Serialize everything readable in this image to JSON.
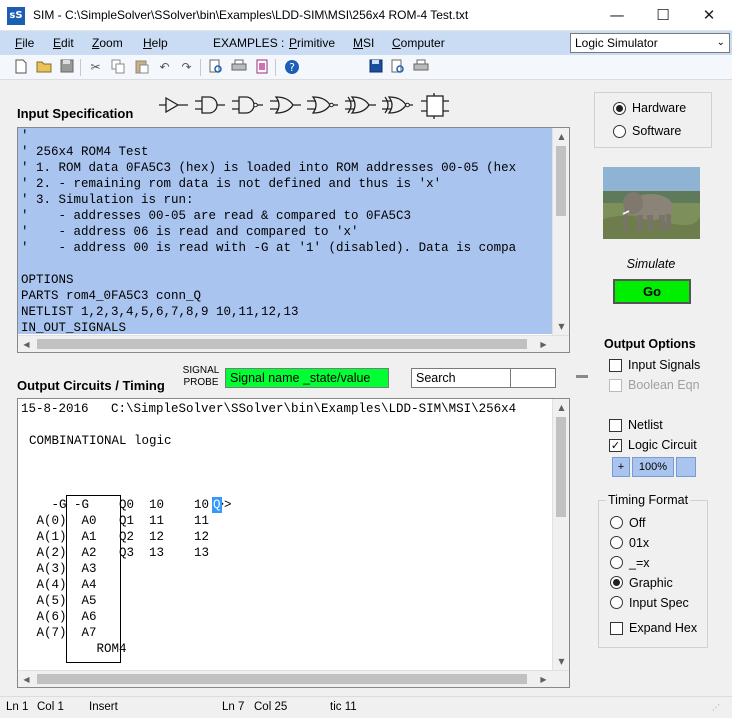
{
  "window": {
    "app_icon": "sS",
    "title": "SIM - C:\\SimpleSolver\\SSolver\\bin\\Examples\\LDD-SIM\\MSI\\256x4 ROM-4 Test.txt",
    "minimize": "—",
    "maximize": "☐",
    "close": "✕"
  },
  "menu": {
    "file": "File",
    "edit": "Edit",
    "zoom": "Zoom",
    "help": "Help",
    "examples_label": "EXAMPLES :",
    "primitive": "Primitive",
    "msi": "MSI",
    "computer": "Computer"
  },
  "mode_select": {
    "value": "Logic Simulator"
  },
  "toolbar_icons": [
    "new-file-icon",
    "open-folder-icon",
    "save-icon",
    "cut-icon",
    "copy-icon",
    "paste-icon",
    "undo-icon",
    "redo-icon",
    "print-preview-icon",
    "print-icon",
    "page-setup-icon",
    "help-icon",
    "save-output-icon",
    "print-preview-output-icon",
    "print-output-icon"
  ],
  "input_spec": {
    "title": "Input Specification",
    "gate_icons": [
      "buffer-gate-icon",
      "and-gate-icon",
      "nand-gate-icon",
      "or-gate-icon",
      "nor-gate-icon",
      "xor-gate-icon",
      "xnor-gate-icon",
      "flipflop-icon"
    ],
    "text": "'\n' 256x4 ROM4 Test\n' 1. ROM data 0FA5C3 (hex) is loaded into ROM addresses 00-05 (hex\n' 2. - remaining rom data is not defined and thus is 'x'\n' 3. Simulation is run:\n'    - addresses 00-05 are read & compared to 0FA5C3\n'    - address 06 is read and compared to 'x'\n'    - address 00 is read with -G at '1' (disabled). Data is compa\n\nOPTIONS\nPARTS rom4_0FA5C3 conn_Q\nNETLIST 1,2,3,4,5,6,7,8,9 10,11,12,13\nIN_OUT_SIGNALS"
  },
  "output_circuits": {
    "title": "Output Circuits / Timing",
    "probe_label": "SIGNAL\nPROBE",
    "probe_value": "Signal name _state/value",
    "search_value": "Search",
    "header_line": "15-8-2016   C:\\SimpleSolver\\SSolver\\bin\\Examples\\LDD-SIM\\MSI\\256x4",
    "logic_title": "COMBINATIONAL logic",
    "circuit_lines": [
      "   -G -G    Q0  10    10 >> ",
      " A(0)  A0   Q1  11    11",
      " A(1)  A1   Q2  12    12",
      " A(2)  A2   Q3  13    13",
      " A(3)  A3",
      " A(4)  A4",
      " A(5)  A5",
      " A(6)  A6",
      " A(7)  A7",
      "         ROM4"
    ],
    "cursor_char": "Q"
  },
  "side_panel": {
    "hardware": "Hardware",
    "software": "Software",
    "engine_selected": "Hardware",
    "simulate_label": "Simulate",
    "go_label": "Go",
    "output_options_title": "Output Options",
    "input_signals": "Input Signals",
    "boolean_eqn": "Boolean Eqn",
    "netlist": "Netlist",
    "logic_circuit": "Logic Circuit",
    "zoom_in": "+",
    "zoom_level": "100%",
    "timing_format_title": "Timing Format",
    "timing_off": "Off",
    "timing_01x": "01x",
    "timing_eqx": "_=x",
    "timing_graphic": "Graphic",
    "timing_input_spec": "Input Spec",
    "expand_hex": "Expand Hex"
  },
  "status": {
    "ln1": "Ln 1",
    "col1": "Col 1",
    "mode": "Insert",
    "ln2": "Ln 7",
    "col2": "Col 25",
    "tic": "tic 11"
  }
}
